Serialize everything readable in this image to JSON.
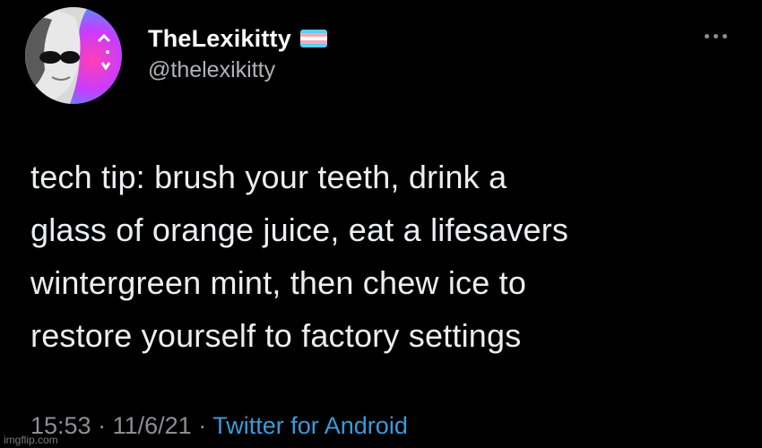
{
  "user": {
    "display_name": "TheLexikitty",
    "handle": "@thelexikitty",
    "flag_colors": [
      "#5bcefa",
      "#f5a9b8",
      "#ffffff",
      "#f5a9b8",
      "#5bcefa"
    ]
  },
  "tweet": {
    "lines": [
      "tech tip: brush your teeth, drink a",
      "glass of orange juice, eat a lifesavers",
      "wintergreen mint, then chew ice to",
      "restore yourself to factory settings"
    ],
    "time": "15:53",
    "date": "11/6/21",
    "separator": "·",
    "source": "Twitter for Android"
  },
  "watermark": "imgflip.com",
  "icons": {
    "more": "more-options-icon",
    "flag": "transgender-flag-icon"
  }
}
